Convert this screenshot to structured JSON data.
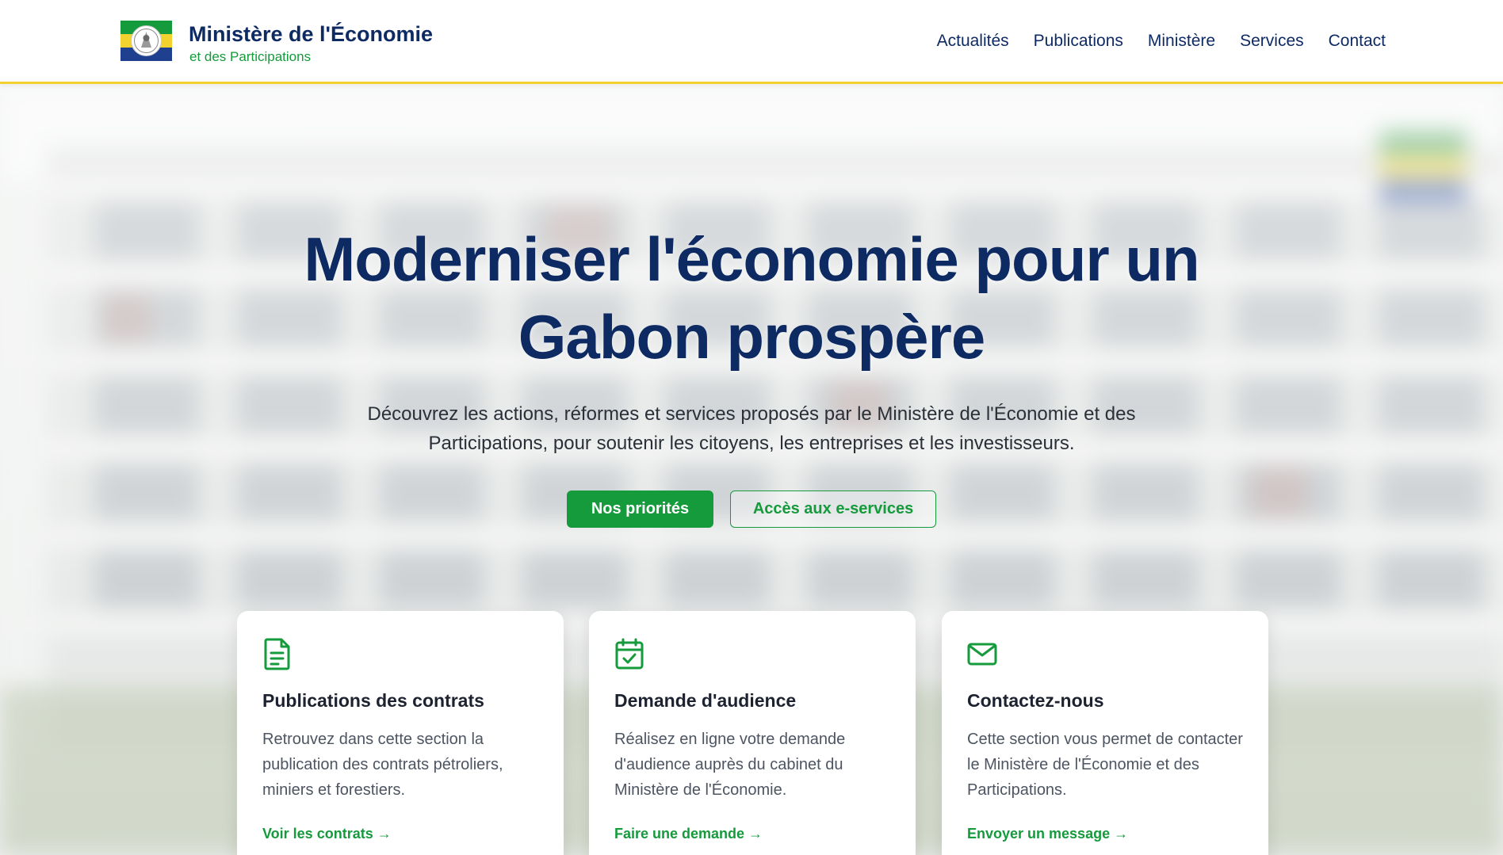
{
  "header": {
    "logo_icon": "gabon-flag-coat-of-arms-logo",
    "title": "Ministère de l'Économie",
    "subtitle": "et des Participations"
  },
  "nav": {
    "items": [
      {
        "label": "Actualités"
      },
      {
        "label": "Publications"
      },
      {
        "label": "Ministère"
      },
      {
        "label": "Services"
      },
      {
        "label": "Contact"
      }
    ]
  },
  "hero": {
    "title_line1": "Moderniser l'économie pour un",
    "title_line2": "Gabon prospère",
    "description": "Découvrez les actions, réformes et services proposés par le Ministère de l'Économie et des Participations, pour soutenir les citoyens, les entreprises et les investisseurs.",
    "primary_button": "Nos priorités",
    "secondary_button": "Accès aux e-services"
  },
  "cards": [
    {
      "icon": "document-icon",
      "title": "Publications des contrats",
      "text": "Retrouvez dans cette section la publication des contrats pétroliers, miniers et forestiers.",
      "link": "Voir les contrats →"
    },
    {
      "icon": "calendar-check-icon",
      "title": "Demande d'audience",
      "text": "Réalisez en ligne votre demande d'audience auprès du cabinet du Ministère de l'Économie.",
      "link": "Faire une demande →"
    },
    {
      "icon": "mail-icon",
      "title": "Contactez-nous",
      "text": "Cette section vous permet de contacter le Ministère de l'Économie et des Participations.",
      "link": "Envoyer un message →"
    }
  ],
  "colors": {
    "navy": "#0e2a63",
    "green": "#159a3c",
    "yellow": "#f2d22e",
    "blue": "#1f3f8f"
  }
}
